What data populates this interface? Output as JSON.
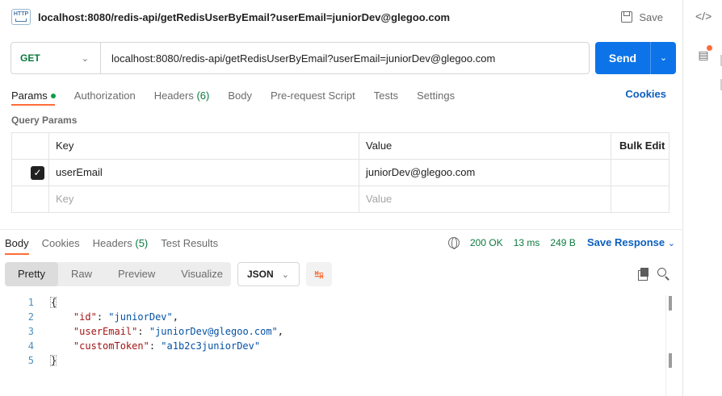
{
  "request": {
    "title": "localhost:8080/redis-api/getRedisUserByEmail?userEmail=juniorDev@glegoo.com",
    "save_label": "Save",
    "method": "GET",
    "url": "localhost:8080/redis-api/getRedisUserByEmail?userEmail=juniorDev@glegoo.com",
    "send_label": "Send",
    "http_icon_text": "HTTP"
  },
  "tabs": [
    {
      "label": "Params",
      "active": true
    },
    {
      "label": "Authorization"
    },
    {
      "label": "Headers",
      "count": "(6)"
    },
    {
      "label": "Body"
    },
    {
      "label": "Pre-request Script"
    },
    {
      "label": "Tests"
    },
    {
      "label": "Settings"
    }
  ],
  "cookies_label": "Cookies",
  "query_params": {
    "section_label": "Query Params",
    "columns": {
      "key": "Key",
      "value": "Value",
      "bulk_edit": "Bulk Edit"
    },
    "rows": [
      {
        "checked": true,
        "key": "userEmail",
        "value": "juniorDev@glegoo.com"
      }
    ],
    "placeholder_key": "Key",
    "placeholder_value": "Value"
  },
  "response": {
    "tabs": [
      {
        "label": "Body",
        "active": true
      },
      {
        "label": "Cookies"
      },
      {
        "label": "Headers",
        "count": "(5)"
      },
      {
        "label": "Test Results"
      }
    ],
    "status": "200 OK",
    "time": "13 ms",
    "size": "249 B",
    "save_response_label": "Save Response",
    "view_modes": [
      "Pretty",
      "Raw",
      "Preview",
      "Visualize"
    ],
    "active_view": "Pretty",
    "format": "JSON",
    "lines": [
      {
        "num": "1",
        "open": true
      },
      {
        "num": "2",
        "key": "\"id\"",
        "value": "\"juniorDev\"",
        "comma": true
      },
      {
        "num": "3",
        "key": "\"userEmail\"",
        "value": "\"juniorDev@glegoo.com\"",
        "comma": true
      },
      {
        "num": "4",
        "key": "\"customToken\"",
        "value": "\"a1b2c3juniorDev\"",
        "comma": false
      },
      {
        "num": "5",
        "close": true
      }
    ]
  },
  "colors": {
    "accent": "#ff6c37",
    "send_blue": "#0c74e8",
    "status_green": "#0b7a3e",
    "link_blue": "#0c5fbf"
  },
  "icons": {
    "code": "code-icon",
    "info": "info-icon",
    "globe": "globe-icon",
    "copy": "copy-icon",
    "search": "search-icon",
    "wrap": "wrap-lines-icon",
    "save": "save-icon"
  }
}
